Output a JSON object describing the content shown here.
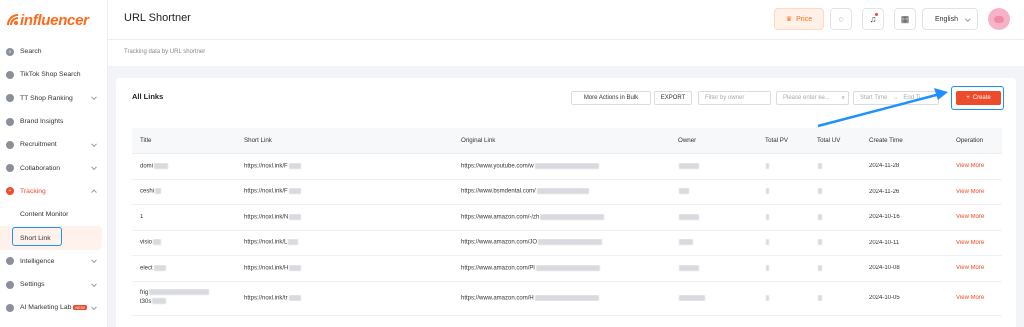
{
  "brand": {
    "logo_text": "influencer"
  },
  "sidebar": {
    "items": [
      {
        "label": "Search",
        "icon": "search-icon"
      },
      {
        "label": "TikTok Shop Search",
        "icon": "shop-icon"
      },
      {
        "label": "TT Shop Ranking",
        "icon": "ranking-icon",
        "expandable": true
      },
      {
        "label": "Brand Insights",
        "icon": "insights-icon"
      },
      {
        "label": "Recruitment",
        "icon": "people-icon",
        "expandable": true
      },
      {
        "label": "Collaboration",
        "icon": "collaboration-icon",
        "expandable": true
      },
      {
        "label": "Tracking",
        "icon": "tracking-icon",
        "expandable": true,
        "expanded": true
      }
    ],
    "tracking_sub": [
      {
        "label": "Content Monitor"
      },
      {
        "label": "Short Link"
      }
    ],
    "items_after": [
      {
        "label": "Intelligence",
        "icon": "intelligence-icon",
        "expandable": true
      },
      {
        "label": "Settings",
        "icon": "settings-icon",
        "expandable": true
      },
      {
        "label": "AI Marketing Lab",
        "icon": "ai-lab-icon",
        "badge": "NEW",
        "expandable": true
      }
    ]
  },
  "header": {
    "title": "URL Shortner",
    "price_label": "Price",
    "language": "English",
    "subtitle": "Tracking data by URL shortner"
  },
  "card": {
    "title": "All Links",
    "toolbar": {
      "bulk_label": "More Actions in Bulk",
      "export_label": "EXPORT",
      "owner_placeholder": "Filter by owner",
      "keyword_placeholder": "Please enter ke...",
      "start_time_placeholder": "Start Time",
      "separator": "→",
      "end_time_placeholder": "End Ti",
      "create_label": "Create"
    },
    "columns": [
      "Title",
      "Short Link",
      "Original Link",
      "Owner",
      "Total PV",
      "Total UV",
      "Create Time",
      "Operation"
    ],
    "rows": [
      {
        "title": "domi",
        "short": "https://noxl.ink/F",
        "original": "https://www.youtube.com/w",
        "date": "2024-11-28",
        "op": "View More"
      },
      {
        "title": "ceshi",
        "short": "https://noxl.ink/F",
        "original": "https://www.bsmdental.com/",
        "date": "2024-11-26",
        "op": "View More"
      },
      {
        "title": "1",
        "short": "https://noxl.ink/N",
        "original": "https://www.amazon.com/-/zh",
        "date": "2024-10-16",
        "op": "View More"
      },
      {
        "title": "visio",
        "short": "https://noxl.ink/L",
        "original": "https://www.amazon.com/JO",
        "date": "2024-10-11",
        "op": "View More"
      },
      {
        "title": "elect",
        "short": "https://noxl.ink/H",
        "original": "https://www.amazon.com/Pl",
        "date": "2024-10-08",
        "op": "View More"
      },
      {
        "title": "frig",
        "title2": "t30s",
        "short": "https://noxl.ink/tr",
        "original": "https://www.amazon.com/H",
        "date": "2024-10-05",
        "op": "View More"
      }
    ]
  },
  "colors": {
    "accent": "#ee4b2b",
    "brand": "#ff6a1a",
    "highlight": "#1e90ff"
  }
}
